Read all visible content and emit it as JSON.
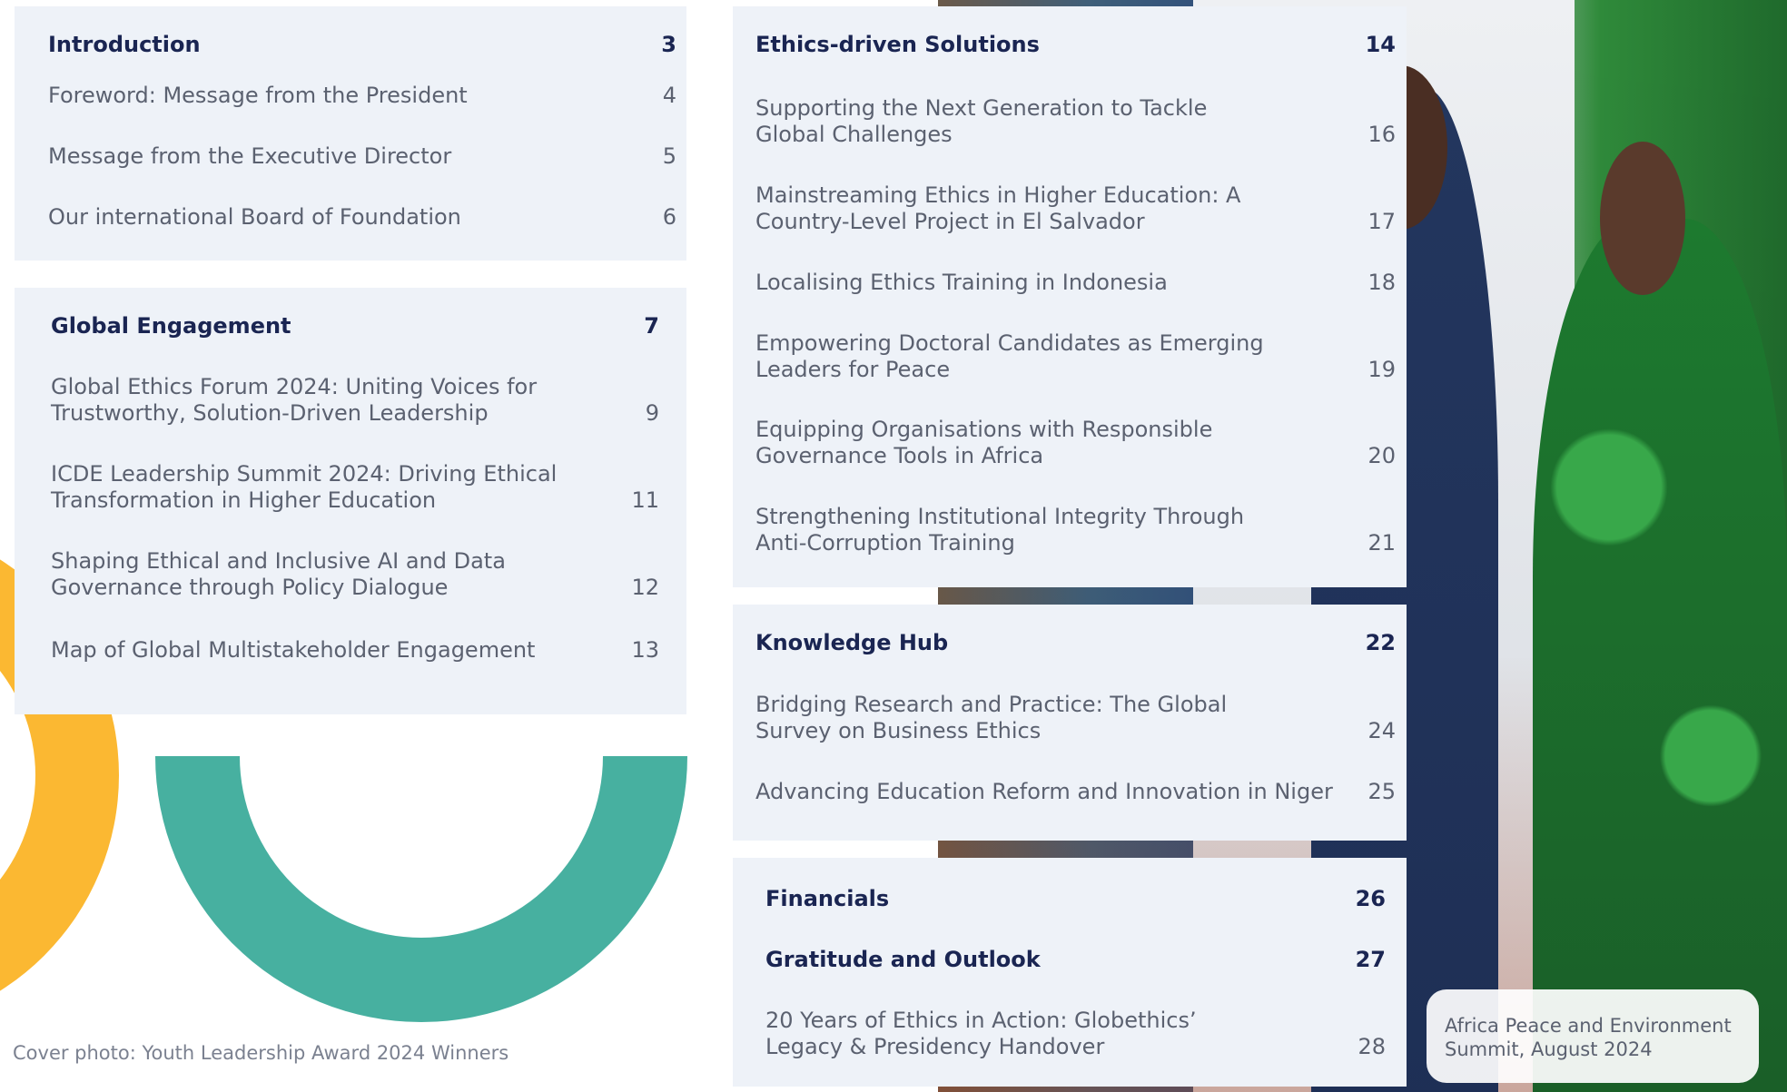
{
  "contents": {
    "introduction": {
      "title": "Introduction",
      "page": "3",
      "items": [
        {
          "title": "Foreword: Message from the President",
          "page": "4"
        },
        {
          "title": "Message from the Executive Director",
          "page": "5"
        },
        {
          "title": "Our international Board of Foundation",
          "page": "6"
        }
      ]
    },
    "global_engagement": {
      "title": "Global Engagement",
      "page": "7",
      "items": [
        {
          "title": "Global Ethics Forum 2024: Uniting Voices for Trustworthy, Solution-Driven Leadership",
          "page": "9"
        },
        {
          "title": "ICDE Leadership Summit 2024: Driving Ethical Transformation in Higher Education",
          "page": "11"
        },
        {
          "title": "Shaping Ethical and Inclusive AI and Data Governance through Policy Dialogue",
          "page": "12"
        },
        {
          "title": "Map of Global Multistakeholder Engagement",
          "page": "13"
        }
      ]
    },
    "ethics_driven": {
      "title": "Ethics-driven Solutions",
      "page": "14",
      "items": [
        {
          "title": "Supporting the Next Generation to Tackle Global Challenges",
          "page": "16"
        },
        {
          "title": "Mainstreaming Ethics in Higher Education: A Country-Level Project in El Salvador",
          "page": "17"
        },
        {
          "title": "Localising Ethics Training in Indonesia",
          "page": "18"
        },
        {
          "title": "Empowering Doctoral Candidates as Emerging Leaders for Peace",
          "page": "19"
        },
        {
          "title": "Equipping Organisations with Responsible Governance Tools in Africa",
          "page": "20"
        },
        {
          "title": "Strengthening Institutional Integrity Through Anti-Corruption Training",
          "page": "21"
        }
      ]
    },
    "knowledge_hub": {
      "title": "Knowledge Hub",
      "page": "22",
      "items": [
        {
          "title": "Bridging Research and Practice: The Global Survey on Business Ethics",
          "page": "24"
        },
        {
          "title": "Advancing Education Reform and Innovation in Niger",
          "page": "25"
        }
      ]
    },
    "financials": {
      "title": "Financials",
      "page": "26"
    },
    "gratitude": {
      "title": "Gratitude and Outlook",
      "page": "27",
      "items": [
        {
          "title": "20 Years of Ethics in Action: Globethics’ Legacy & Presidency Handover",
          "page": "28"
        }
      ]
    }
  },
  "photo_caption": "Africa Peace and Environment Summit, August 2024",
  "cover_credit": "Cover photo: Youth Leadership Award 2024 Winners",
  "colors": {
    "navy": "#1a2552",
    "panel": "#eef2f8",
    "yellow": "#fbb832",
    "teal": "#47b0a0"
  }
}
